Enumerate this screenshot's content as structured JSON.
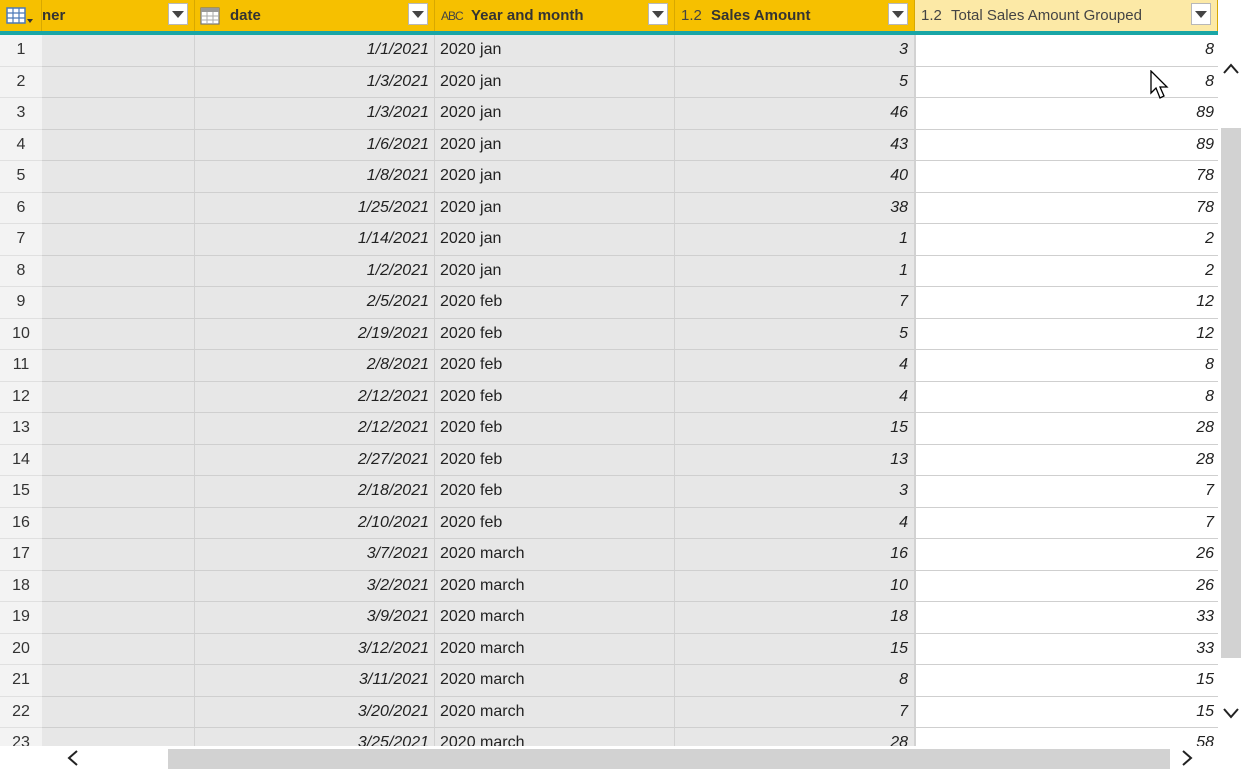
{
  "columns": {
    "owner": {
      "label": "ner"
    },
    "date": {
      "label": "date"
    },
    "year_month": {
      "label": "Year and month",
      "type_glyph": "ABC"
    },
    "sales": {
      "label": "Sales Amount",
      "type_glyph": "1.2"
    },
    "total": {
      "label": "Total Sales Amount Grouped",
      "type_glyph": "1.2"
    }
  },
  "rows": [
    {
      "n": "1",
      "date": "1/1/2021",
      "ym": "2020 jan",
      "sales": "3",
      "total": "8"
    },
    {
      "n": "2",
      "date": "1/3/2021",
      "ym": "2020 jan",
      "sales": "5",
      "total": "8"
    },
    {
      "n": "3",
      "date": "1/3/2021",
      "ym": "2020 jan",
      "sales": "46",
      "total": "89"
    },
    {
      "n": "4",
      "date": "1/6/2021",
      "ym": "2020 jan",
      "sales": "43",
      "total": "89"
    },
    {
      "n": "5",
      "date": "1/8/2021",
      "ym": "2020 jan",
      "sales": "40",
      "total": "78"
    },
    {
      "n": "6",
      "date": "1/25/2021",
      "ym": "2020 jan",
      "sales": "38",
      "total": "78"
    },
    {
      "n": "7",
      "date": "1/14/2021",
      "ym": "2020 jan",
      "sales": "1",
      "total": "2"
    },
    {
      "n": "8",
      "date": "1/2/2021",
      "ym": "2020 jan",
      "sales": "1",
      "total": "2"
    },
    {
      "n": "9",
      "date": "2/5/2021",
      "ym": "2020 feb",
      "sales": "7",
      "total": "12"
    },
    {
      "n": "10",
      "date": "2/19/2021",
      "ym": "2020 feb",
      "sales": "5",
      "total": "12"
    },
    {
      "n": "11",
      "date": "2/8/2021",
      "ym": "2020 feb",
      "sales": "4",
      "total": "8"
    },
    {
      "n": "12",
      "date": "2/12/2021",
      "ym": "2020 feb",
      "sales": "4",
      "total": "8"
    },
    {
      "n": "13",
      "date": "2/12/2021",
      "ym": "2020 feb",
      "sales": "15",
      "total": "28"
    },
    {
      "n": "14",
      "date": "2/27/2021",
      "ym": "2020 feb",
      "sales": "13",
      "total": "28"
    },
    {
      "n": "15",
      "date": "2/18/2021",
      "ym": "2020 feb",
      "sales": "3",
      "total": "7"
    },
    {
      "n": "16",
      "date": "2/10/2021",
      "ym": "2020 feb",
      "sales": "4",
      "total": "7"
    },
    {
      "n": "17",
      "date": "3/7/2021",
      "ym": "2020 march",
      "sales": "16",
      "total": "26"
    },
    {
      "n": "18",
      "date": "3/2/2021",
      "ym": "2020 march",
      "sales": "10",
      "total": "26"
    },
    {
      "n": "19",
      "date": "3/9/2021",
      "ym": "2020 march",
      "sales": "18",
      "total": "33"
    },
    {
      "n": "20",
      "date": "3/12/2021",
      "ym": "2020 march",
      "sales": "15",
      "total": "33"
    },
    {
      "n": "21",
      "date": "3/11/2021",
      "ym": "2020 march",
      "sales": "8",
      "total": "15"
    },
    {
      "n": "22",
      "date": "3/20/2021",
      "ym": "2020 march",
      "sales": "7",
      "total": "15"
    },
    {
      "n": "23",
      "date": "3/25/2021",
      "ym": "2020 march",
      "sales": "28",
      "total": "58"
    }
  ],
  "icons": {
    "table_menu": "table-icon",
    "date_type": "calendar-icon",
    "scroll_up": "chevron-up-icon",
    "scroll_down": "chevron-down-icon",
    "scroll_left": "chevron-left-icon",
    "scroll_right": "chevron-right-icon",
    "cursor": "mouse-cursor-icon"
  },
  "colors": {
    "header_bg": "#f6c000",
    "header_accent": "#1aa6a6",
    "loaded_column_bg": "#e7e7e7"
  }
}
